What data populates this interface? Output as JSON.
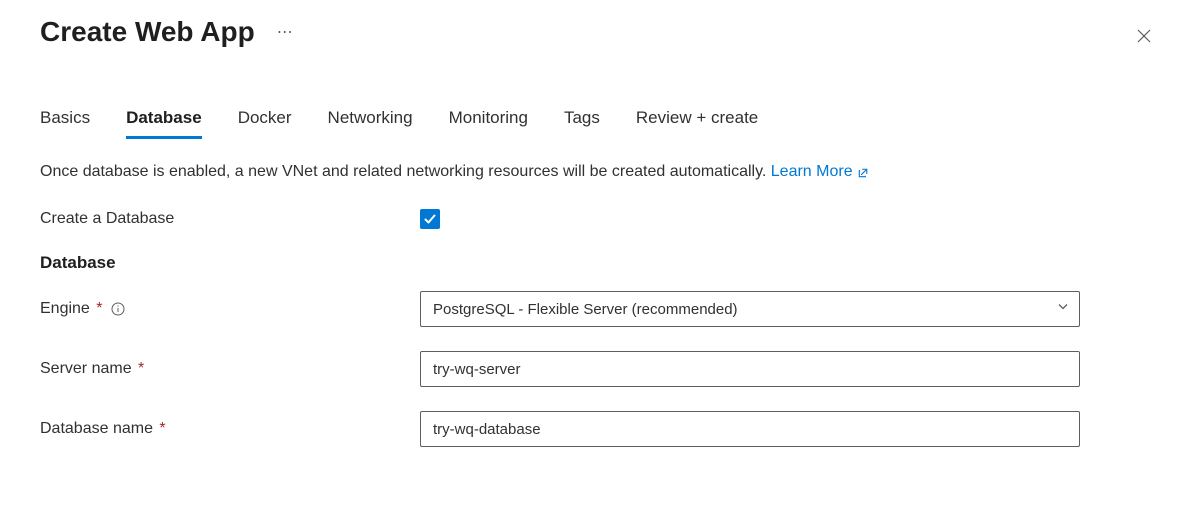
{
  "header": {
    "title": "Create Web App"
  },
  "tabs": [
    {
      "label": "Basics",
      "active": false
    },
    {
      "label": "Database",
      "active": true
    },
    {
      "label": "Docker",
      "active": false
    },
    {
      "label": "Networking",
      "active": false
    },
    {
      "label": "Monitoring",
      "active": false
    },
    {
      "label": "Tags",
      "active": false
    },
    {
      "label": "Review + create",
      "active": false
    }
  ],
  "intro": {
    "text": "Once database is enabled, a new VNet and related networking resources will be created automatically. ",
    "learn_more_label": "Learn More"
  },
  "form": {
    "create_db_label": "Create a Database",
    "create_db_checked": true,
    "section_heading": "Database",
    "engine_label": "Engine",
    "engine_value": "PostgreSQL - Flexible Server (recommended)",
    "server_name_label": "Server name",
    "server_name_value": "try-wq-server",
    "database_name_label": "Database name",
    "database_name_value": "try-wq-database"
  }
}
